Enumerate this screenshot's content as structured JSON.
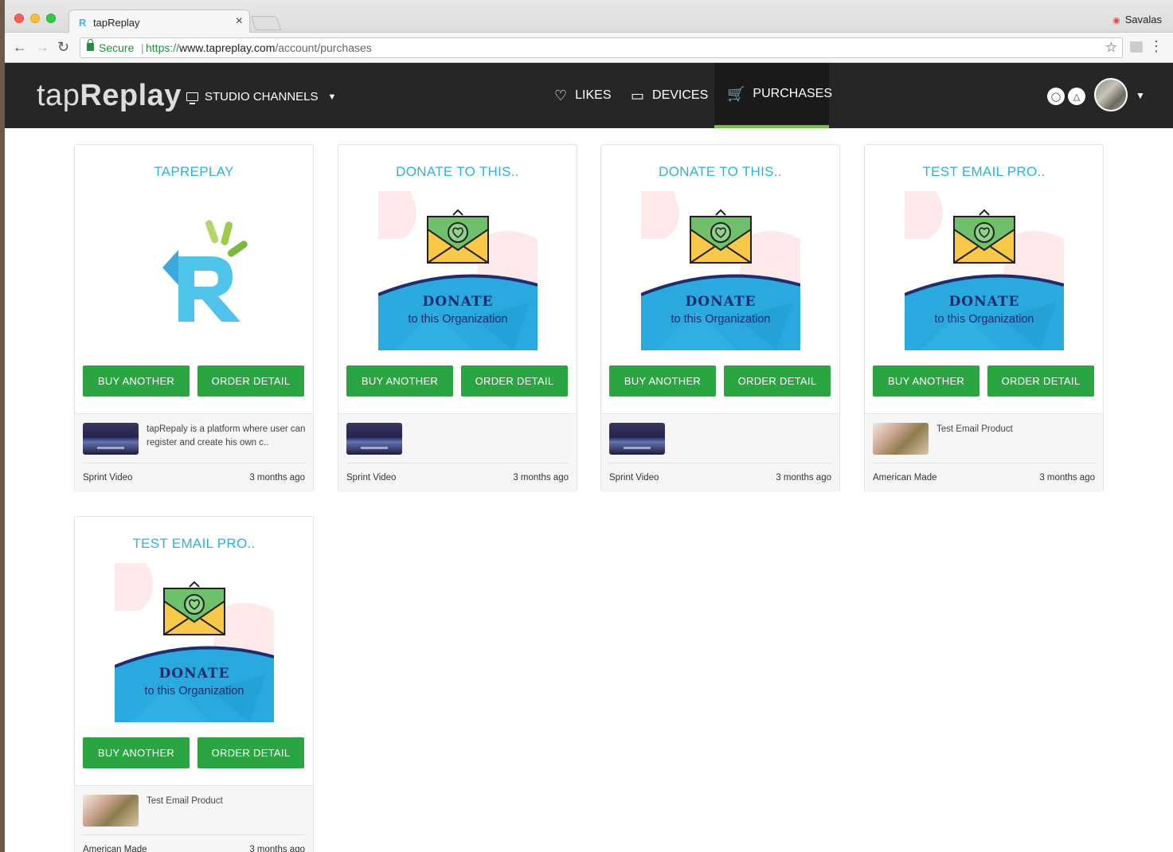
{
  "browser": {
    "tab_title": "tapReplay",
    "tab_close": "×",
    "profile_name": "Savalas",
    "address": {
      "secure_label": "Secure",
      "scheme": "https://",
      "host": "www.tapreplay.com",
      "path": "/account/purchases"
    }
  },
  "header": {
    "logo_light": "tap",
    "logo_bold": "Replay",
    "studio_label": "STUDIO CHANNELS",
    "nav": {
      "likes": "LIKES",
      "devices": "DEVICES",
      "purchases": "PURCHASES"
    },
    "active_nav": "purchases"
  },
  "cards": [
    {
      "title": "TAPREPLAY",
      "image": "tapreplay-logo",
      "buy_label": "BUY ANOTHER",
      "detail_label": "ORDER DETAIL",
      "description": "tapRepaly is a platform where user can register and create his own c..",
      "thumb": "video",
      "category": "Sprint Video",
      "time": "3 months ago"
    },
    {
      "title": "DONATE TO THIS..",
      "image": "donate-graphic",
      "buy_label": "BUY ANOTHER",
      "detail_label": "ORDER DETAIL",
      "description": "",
      "thumb": "video",
      "category": "Sprint Video",
      "time": "3 months ago"
    },
    {
      "title": "DONATE TO THIS..",
      "image": "donate-graphic",
      "buy_label": "BUY ANOTHER",
      "detail_label": "ORDER DETAIL",
      "description": "",
      "thumb": "video",
      "category": "Sprint Video",
      "time": "3 months ago"
    },
    {
      "title": "TEST EMAIL PRO..",
      "image": "donate-graphic",
      "buy_label": "BUY ANOTHER",
      "detail_label": "ORDER DETAIL",
      "description": "Test Email Product",
      "thumb": "photo",
      "category": "American Made",
      "time": "3 months ago"
    },
    {
      "title": "TEST EMAIL PRO..",
      "image": "donate-graphic",
      "buy_label": "BUY ANOTHER",
      "detail_label": "ORDER DETAIL",
      "description": "Test Email Product",
      "thumb": "photo",
      "category": "American Made",
      "time": "3 months ago"
    }
  ],
  "donate_graphic": {
    "headline": "DONATE",
    "subline": "to this Organization"
  },
  "colors": {
    "accent_title": "#2bb3d9",
    "button_green": "#2aa542",
    "active_underline": "#74c043",
    "header_bg": "#262626"
  }
}
